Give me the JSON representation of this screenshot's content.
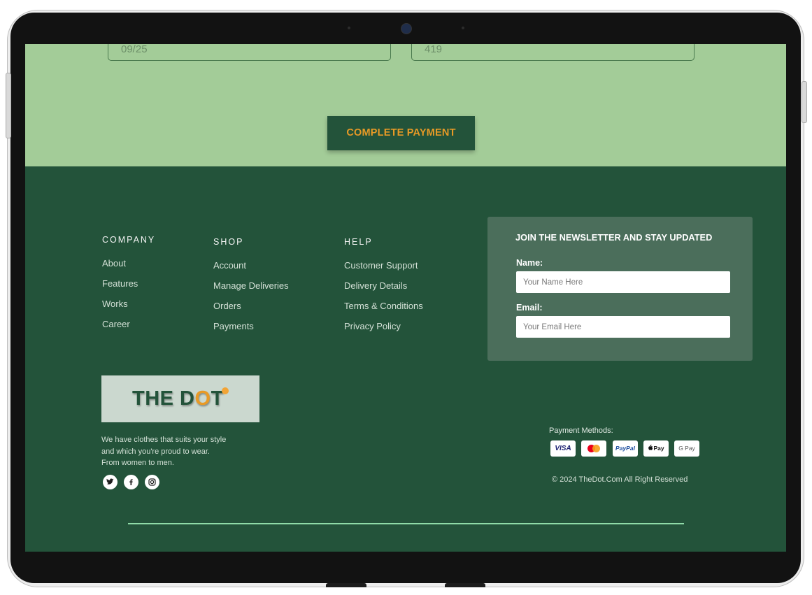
{
  "payment_form": {
    "expiry_value": "09/25",
    "cvv_value": "419",
    "complete_label": "COMPLETE PAYMENT"
  },
  "footer": {
    "company": {
      "heading": "COMPANY",
      "links": [
        "About",
        "Features",
        "Works",
        "Career"
      ]
    },
    "shop": {
      "heading": "SHOP",
      "links": [
        "Account",
        "Manage Deliveries",
        "Orders",
        "Payments"
      ]
    },
    "help": {
      "heading": "HELP",
      "links": [
        "Customer Support",
        "Delivery Details",
        "Terms & Conditions",
        "Privacy Policy"
      ]
    },
    "newsletter": {
      "title": "JOIN THE NEWSLETTER AND STAY UPDATED",
      "name_label": "Name:",
      "name_placeholder": "Your Name Here",
      "email_label": "Email:",
      "email_placeholder": "Your Email Here"
    },
    "brand": {
      "logo_text_a": "THE D",
      "logo_text_o": "O",
      "logo_text_b": "T",
      "tagline": "We have clothes that suits your style and which you're proud to wear. From women to men."
    },
    "social_icons": [
      "twitter-icon",
      "facebook-icon",
      "instagram-icon"
    ],
    "payment": {
      "label": "Payment Methods:",
      "cards": [
        "VISA",
        "mastercard",
        "PayPal",
        "Pay",
        "G Pay"
      ]
    },
    "copyright": "© 2024 TheDot.Com All Right Reserved"
  },
  "colors": {
    "brand_green": "#23533a",
    "light_green": "#a3cc98",
    "accent_orange": "#e89a26",
    "divider_mint": "#8fdba8"
  }
}
